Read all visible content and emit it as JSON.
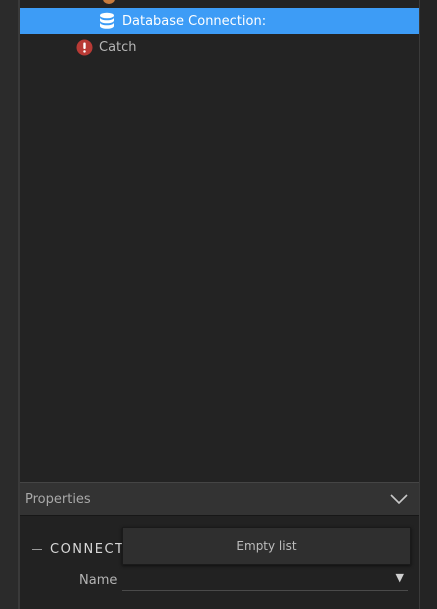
{
  "tree": {
    "items": [
      {
        "label": "Database Connection:",
        "icon": "database-icon",
        "selected": true
      },
      {
        "label": "Catch",
        "icon": "error-icon",
        "selected": false
      }
    ]
  },
  "properties": {
    "title": "Properties",
    "section_title": "CONNECT",
    "field_label": "Name",
    "field_value": "",
    "dropdown_message": "Empty list"
  },
  "colors": {
    "selection": "#3d9cf6",
    "error": "#c0392b",
    "background": "#232323"
  }
}
